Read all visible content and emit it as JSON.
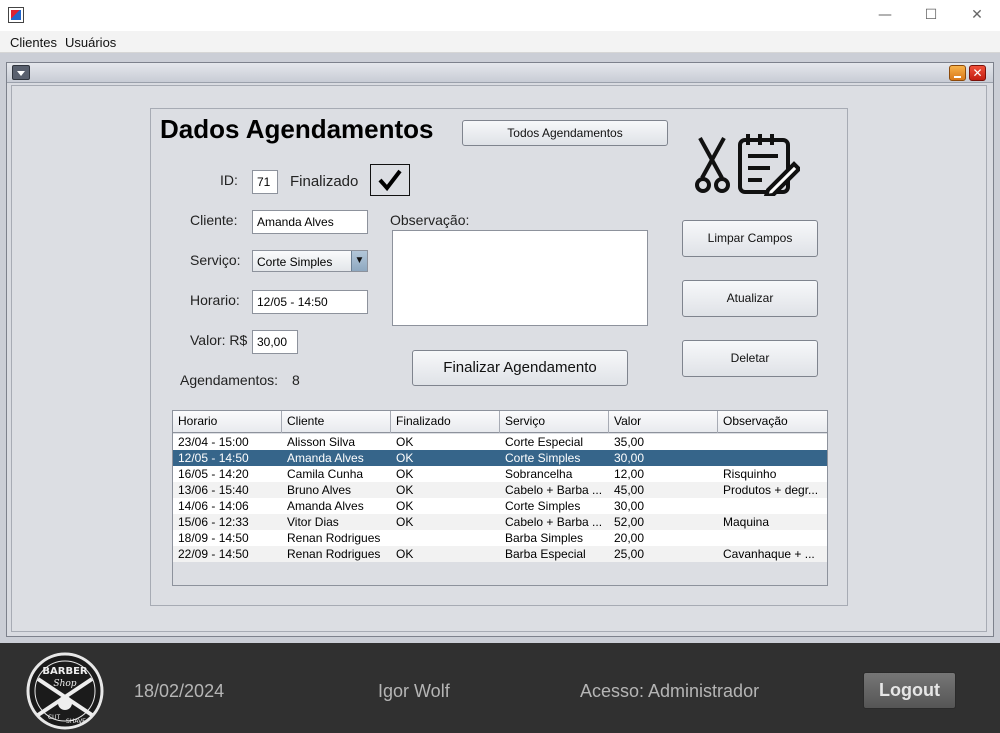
{
  "window": {
    "controls": {
      "minimize": "—",
      "maximize": "☐",
      "close": "✕"
    }
  },
  "menu": {
    "items": [
      {
        "label": "Clientes"
      },
      {
        "label": "Usuários"
      }
    ]
  },
  "form": {
    "title": "Dados Agendamentos",
    "all_button": "Todos Agendamentos",
    "id_label": "ID:",
    "id_value": "71",
    "finalizado_label": "Finalizado",
    "finalizado_checked": true,
    "cliente_label": "Cliente:",
    "cliente_value": "Amanda Alves",
    "servico_label": "Serviço:",
    "servico_value": "Corte Simples",
    "horario_label": "Horario:",
    "horario_value": "12/05 - 14:50",
    "valor_label": "Valor: R$",
    "valor_value": "30,00",
    "observacao_label": "Observação:",
    "observacao_value": "",
    "finalizar_button": "Finalizar Agendamento",
    "count_label": "Agendamentos:",
    "count_value": "8",
    "limpar_button": "Limpar Campos",
    "atualizar_button": "Atualizar",
    "deletar_button": "Deletar"
  },
  "table": {
    "columns": [
      "Horario",
      "Cliente",
      "Finalizado",
      "Serviço",
      "Valor",
      "Observação"
    ],
    "selected_index": 1,
    "rows": [
      [
        "23/04 - 15:00",
        "Alisson Silva",
        "OK",
        "Corte Especial",
        "35,00",
        ""
      ],
      [
        "12/05 - 14:50",
        "Amanda Alves",
        "OK",
        "Corte Simples",
        "30,00",
        ""
      ],
      [
        "16/05 - 14:20",
        "Camila Cunha",
        "OK",
        "Sobrancelha",
        "12,00",
        "Risquinho"
      ],
      [
        "13/06 - 15:40",
        "Bruno Alves",
        "OK",
        "Cabelo + Barba ...",
        "45,00",
        "Produtos + degr..."
      ],
      [
        "14/06 - 14:06",
        "Amanda Alves",
        "OK",
        "Corte Simples",
        "30,00",
        ""
      ],
      [
        "15/06 - 12:33",
        "Vitor Dias",
        "OK",
        "Cabelo + Barba ...",
        "52,00",
        "Maquina"
      ],
      [
        "18/09 - 14:50",
        "Renan Rodrigues",
        "",
        "Barba Simples",
        "20,00",
        ""
      ],
      [
        "22/09 - 14:50",
        "Renan Rodrigues",
        "OK",
        "Barba Especial",
        "25,00",
        "Cavanhaque + ..."
      ]
    ]
  },
  "footer": {
    "logo": {
      "top": "BARBER",
      "script": "Shop",
      "bottom_left": "CUT",
      "bottom_right": "SHAVE"
    },
    "date": "18/02/2024",
    "user": "Igor Wolf",
    "access": "Acesso: Administrador",
    "logout_button": "Logout"
  },
  "colors": {
    "selection": "#36658a",
    "footer_bg": "#303030",
    "panel_bg": "#dcdee3"
  },
  "icons": [
    "app-icon",
    "scissors-icon",
    "notepad-pen-icon",
    "checkmark-icon",
    "dropdown-arrow-icon",
    "barber-shop-logo"
  ]
}
